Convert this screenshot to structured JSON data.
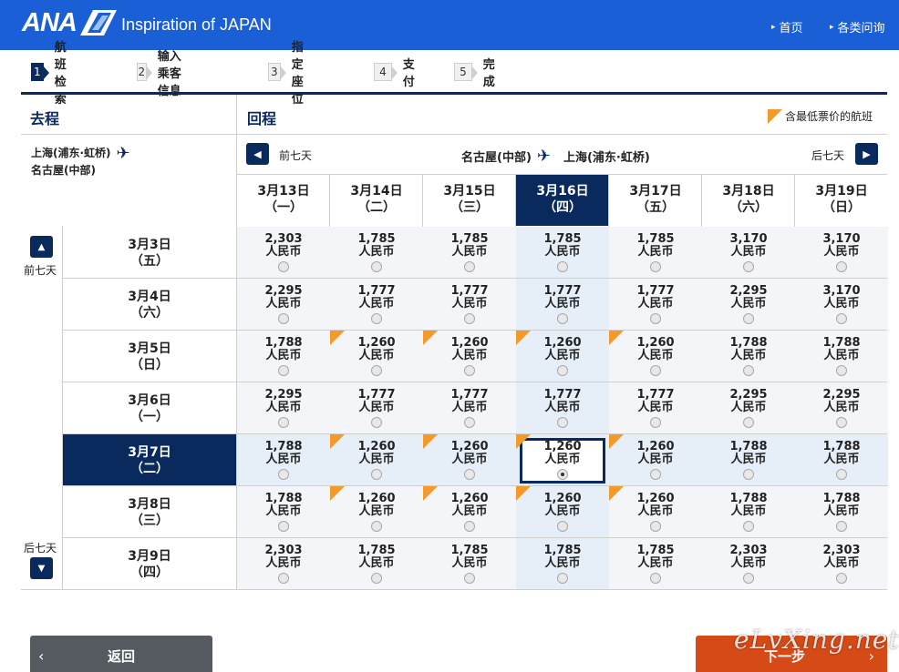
{
  "header": {
    "logo": "ANA",
    "tagline": "Inspiration of JAPAN",
    "nav": [
      "首页",
      "各类问询"
    ]
  },
  "steps": [
    {
      "num": "1",
      "label": "航班检索",
      "active": true
    },
    {
      "num": "2",
      "label": "输入乘客信息",
      "active": false
    },
    {
      "num": "3",
      "label": "指定座位",
      "active": false
    },
    {
      "num": "4",
      "label": "支付",
      "active": false
    },
    {
      "num": "5",
      "label": "完成",
      "active": false
    }
  ],
  "outbound": {
    "title": "去程",
    "route_from": "上海(浦东·虹桥)",
    "route_to": "名古屋(中部)",
    "prev_label": "前七天",
    "next_label": "后七天"
  },
  "return_trip": {
    "title": "回程",
    "legend": "含最低票价的航班",
    "prev_label": "前七天",
    "next_label": "后七天",
    "route_from": "名古屋(中部)",
    "route_to": "上海(浦东·虹桥)"
  },
  "columns": [
    {
      "date": "3月13日",
      "dow": "（一）"
    },
    {
      "date": "3月14日",
      "dow": "（二）"
    },
    {
      "date": "3月15日",
      "dow": "（三）"
    },
    {
      "date": "3月16日",
      "dow": "（四）"
    },
    {
      "date": "3月17日",
      "dow": "（五）"
    },
    {
      "date": "3月18日",
      "dow": "（六）"
    },
    {
      "date": "3月19日",
      "dow": "（日）"
    }
  ],
  "selected_col": 3,
  "selected_row": 4,
  "currency": "人民币",
  "rows": [
    {
      "date": "3月3日",
      "dow": "（五）",
      "prices": [
        "2,303",
        "1,785",
        "1,785",
        "1,785",
        "1,785",
        "3,170",
        "3,170"
      ],
      "lowest": [
        false,
        false,
        false,
        false,
        false,
        false,
        false
      ]
    },
    {
      "date": "3月4日",
      "dow": "（六）",
      "prices": [
        "2,295",
        "1,777",
        "1,777",
        "1,777",
        "1,777",
        "2,295",
        "3,170"
      ],
      "lowest": [
        false,
        false,
        false,
        false,
        false,
        false,
        false
      ]
    },
    {
      "date": "3月5日",
      "dow": "（日）",
      "prices": [
        "1,788",
        "1,260",
        "1,260",
        "1,260",
        "1,260",
        "1,788",
        "1,788"
      ],
      "lowest": [
        false,
        true,
        true,
        true,
        true,
        false,
        false
      ]
    },
    {
      "date": "3月6日",
      "dow": "（一）",
      "prices": [
        "2,295",
        "1,777",
        "1,777",
        "1,777",
        "1,777",
        "2,295",
        "2,295"
      ],
      "lowest": [
        false,
        false,
        false,
        false,
        false,
        false,
        false
      ]
    },
    {
      "date": "3月7日",
      "dow": "（二）",
      "prices": [
        "1,788",
        "1,260",
        "1,260",
        "1,260",
        "1,260",
        "1,788",
        "1,788"
      ],
      "lowest": [
        false,
        true,
        true,
        true,
        true,
        false,
        false
      ]
    },
    {
      "date": "3月8日",
      "dow": "（三）",
      "prices": [
        "1,788",
        "1,260",
        "1,260",
        "1,260",
        "1,260",
        "1,788",
        "1,788"
      ],
      "lowest": [
        false,
        true,
        true,
        true,
        true,
        false,
        false
      ]
    },
    {
      "date": "3月9日",
      "dow": "（四）",
      "prices": [
        "2,303",
        "1,785",
        "1,785",
        "1,785",
        "1,785",
        "2,303",
        "2,303"
      ],
      "lowest": [
        false,
        false,
        false,
        false,
        false,
        false,
        false
      ]
    }
  ],
  "buttons": {
    "back": "返回",
    "next": "下一步"
  },
  "watermark": "eLvXing.net",
  "colors": {
    "header": "#1a5fd6",
    "navy": "#0a2a5e",
    "lowest_marker": "#f39a2b",
    "next_button": "#d54a17",
    "back_button": "#555a60"
  }
}
